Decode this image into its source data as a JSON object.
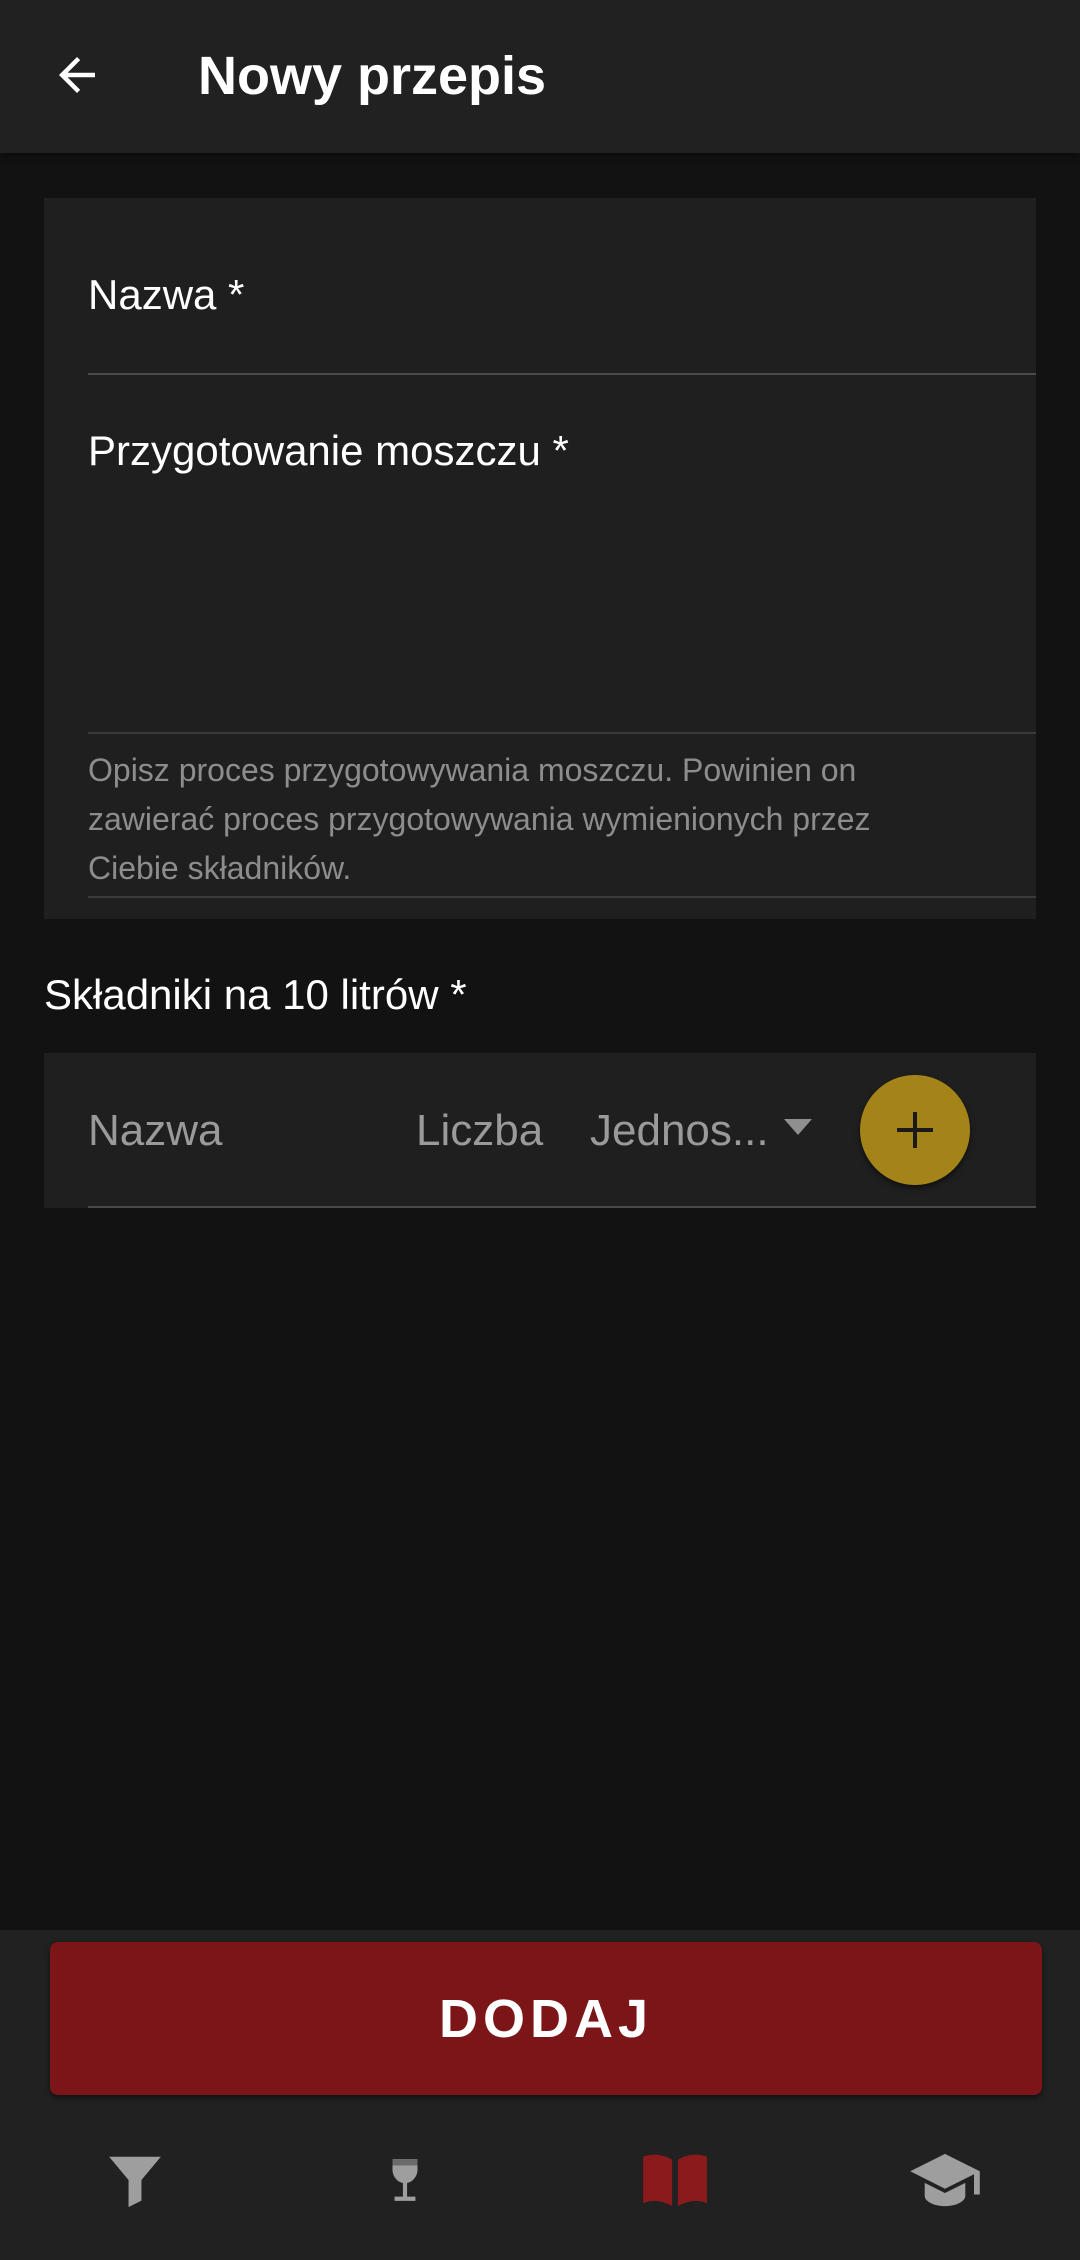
{
  "app_bar": {
    "title": "Nowy przepis",
    "back_icon": "arrow-back-icon"
  },
  "form": {
    "name_label": "Nazwa *",
    "preparation_label": "Przygotowanie moszczu *",
    "preparation_helper": "Opisz proces przygotowywania moszczu. Powinien on zawierać proces przygotowywania wymienionych przez Ciebie składników."
  },
  "ingredients": {
    "title": "Składniki na 10 litrów *",
    "name_placeholder": "Nazwa",
    "amount_placeholder": "Liczba",
    "unit_placeholder": "Jednos...",
    "add_icon": "plus-icon"
  },
  "submit": {
    "label": "DODAJ"
  },
  "bottom_nav": {
    "items": [
      {
        "icon": "filter-icon",
        "active": false
      },
      {
        "icon": "wine-glass-icon",
        "active": false
      },
      {
        "icon": "book-icon",
        "active": true
      },
      {
        "icon": "graduation-cap-icon",
        "active": false
      }
    ]
  },
  "colors": {
    "background": "#121212",
    "surface": "#1f1f1f",
    "bar": "#212121",
    "accent_red": "#7c1518",
    "accent_gold": "#a48419",
    "active_nav": "#8b1a1d",
    "inactive_nav": "#9e9e9e"
  }
}
